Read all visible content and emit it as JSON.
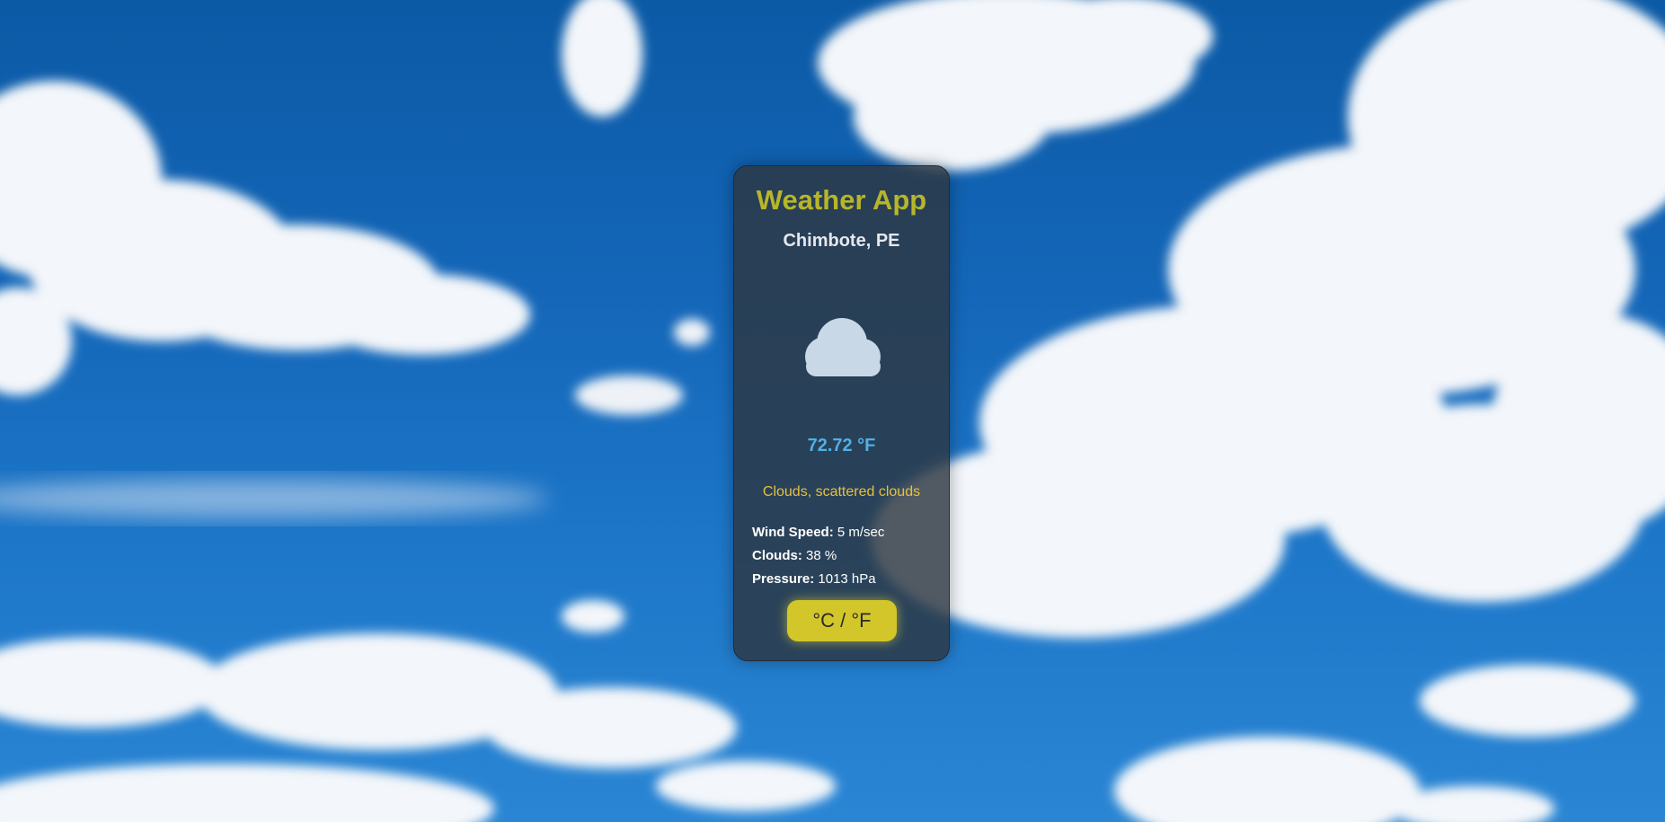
{
  "app": {
    "title": "Weather App"
  },
  "location": "Chimbote, PE",
  "weather_icon": "cloud-icon",
  "temperature": "72.72 °F",
  "description": "Clouds, scattered clouds",
  "details": [
    {
      "label": "Wind Speed:",
      "value": "5 m/sec"
    },
    {
      "label": "Clouds:",
      "value": "38 %"
    },
    {
      "label": "Pressure:",
      "value": "1013 hPa"
    }
  ],
  "toggle_label": "°C / °F",
  "colors": {
    "title": "#b7b629",
    "temperature": "#4fb0e8",
    "description": "#e8c13c",
    "button": "#d3c62b"
  }
}
